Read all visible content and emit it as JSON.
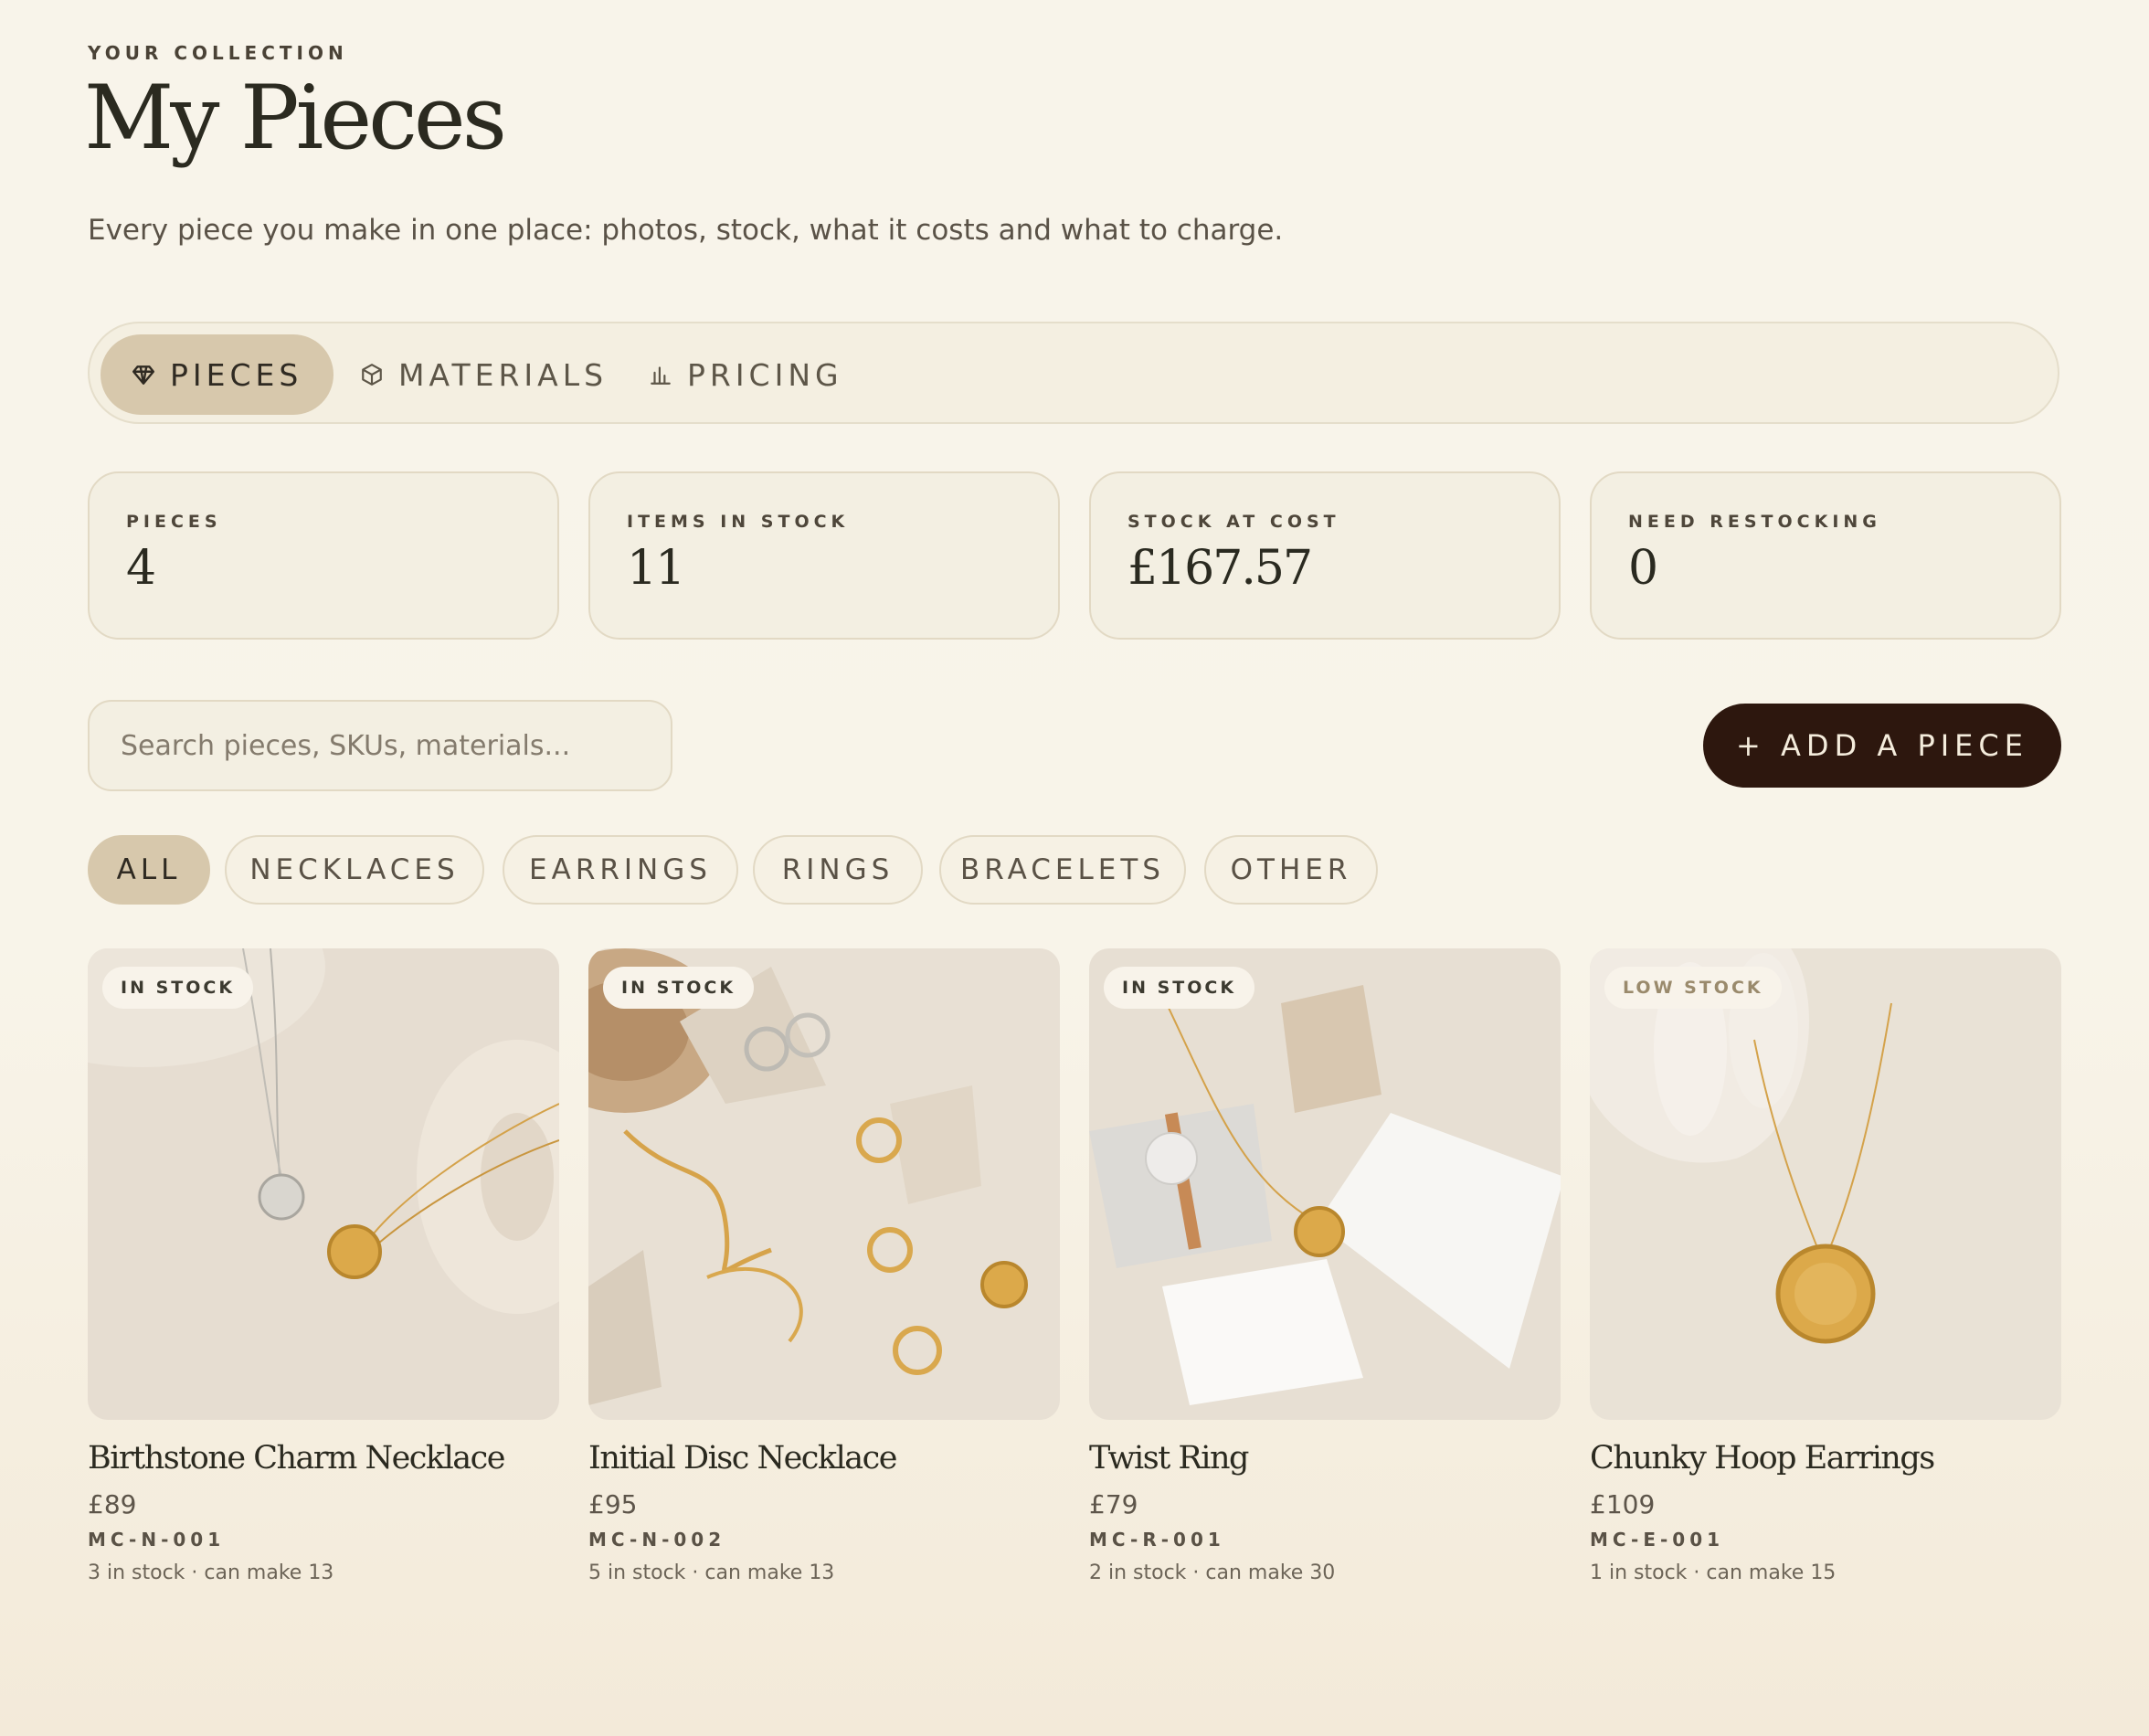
{
  "header": {
    "eyebrow": "YOUR COLLECTION",
    "title": "My Pieces",
    "subtitle": "Every piece you make in one place: photos, stock, what it costs and what to charge."
  },
  "tabs": [
    {
      "label": "PIECES",
      "icon": "diamond-icon",
      "active": true
    },
    {
      "label": "MATERIALS",
      "icon": "cube-icon",
      "active": false
    },
    {
      "label": "PRICING",
      "icon": "bar-chart-icon",
      "active": false
    }
  ],
  "stats": [
    {
      "label": "PIECES",
      "value": "4"
    },
    {
      "label": "ITEMS IN STOCK",
      "value": "11"
    },
    {
      "label": "STOCK AT COST",
      "value": "£167.57"
    },
    {
      "label": "NEED RESTOCKING",
      "value": "0"
    }
  ],
  "search": {
    "placeholder": "Search pieces, SKUs, materials...",
    "value": ""
  },
  "add_button": {
    "label": "+ ADD A PIECE"
  },
  "filters": [
    {
      "label": "ALL",
      "active": true
    },
    {
      "label": "NECKLACES",
      "active": false
    },
    {
      "label": "EARRINGS",
      "active": false
    },
    {
      "label": "RINGS",
      "active": false
    },
    {
      "label": "BRACELETS",
      "active": false
    },
    {
      "label": "OTHER",
      "active": false
    }
  ],
  "products": [
    {
      "badge": "IN STOCK",
      "name": "Birthstone Charm Necklace",
      "price": "£89",
      "sku": "MC-N-001",
      "meta": "3 in stock · can make 13"
    },
    {
      "badge": "IN STOCK",
      "name": "Initial Disc Necklace",
      "price": "£95",
      "sku": "MC-N-002",
      "meta": "5 in stock · can make 13"
    },
    {
      "badge": "IN STOCK",
      "name": "Twist Ring",
      "price": "£79",
      "sku": "MC-R-001",
      "meta": "2 in stock · can make 30"
    },
    {
      "badge": "LOW STOCK",
      "name": "Chunky Hoop Earrings",
      "price": "£109",
      "sku": "MC-E-001",
      "meta": "1 in stock · can make 15"
    }
  ],
  "colors": {
    "background": "#f8f4ea",
    "accent_chip": "#d7c8ac",
    "primary_button": "#2d170e",
    "gold": "#d9a441"
  }
}
